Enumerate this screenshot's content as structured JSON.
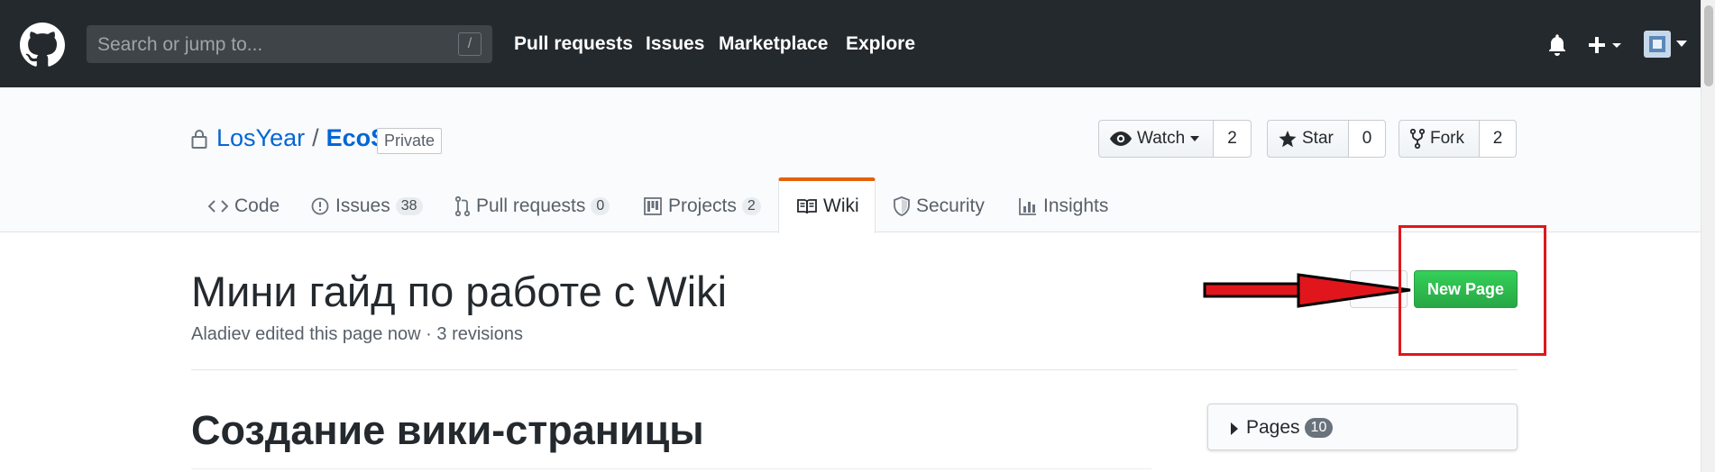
{
  "header": {
    "search_placeholder": "Search or jump to...",
    "slash_key": "/",
    "nav": [
      "Pull requests",
      "Issues",
      "Marketplace",
      "Explore"
    ]
  },
  "repo": {
    "owner": "LosYear",
    "separator": "/",
    "name": "EcoS",
    "visibility": "Private",
    "watch_label": "Watch",
    "watch_count": "2",
    "star_label": "Star",
    "star_count": "0",
    "fork_label": "Fork",
    "fork_count": "2"
  },
  "tabs": [
    {
      "label": "Code",
      "count": ""
    },
    {
      "label": "Issues",
      "count": "38"
    },
    {
      "label": "Pull requests",
      "count": "0"
    },
    {
      "label": "Projects",
      "count": "2"
    },
    {
      "label": "Wiki",
      "count": ""
    },
    {
      "label": "Security",
      "count": ""
    },
    {
      "label": "Insights",
      "count": ""
    }
  ],
  "wiki": {
    "page_title": "Мини гайд по работе с Wiki",
    "meta": "Aladiev edited this page now · 3 revisions",
    "new_page_label": "New Page",
    "section_heading": "Создание вики-страницы",
    "pages_label": "Pages",
    "pages_count": "10"
  },
  "colors": {
    "header_bg": "#24292e",
    "link": "#0366d6",
    "primary_green": "#28a745",
    "selected_tab_accent": "#e36209",
    "annotation_red": "#e0161c"
  }
}
